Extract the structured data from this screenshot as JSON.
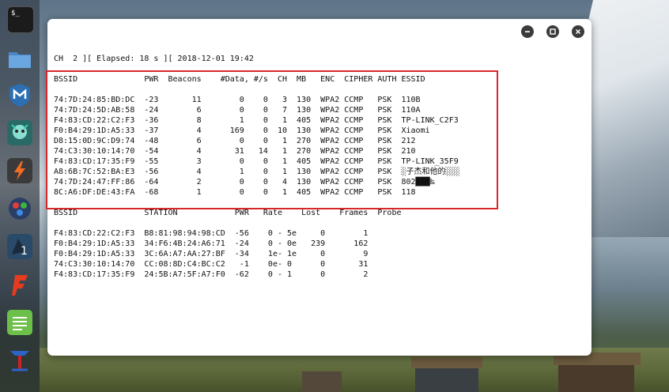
{
  "header_line": "CH  2 ][ Elapsed: 18 s ][ 2018-12-01 19:42",
  "ap_table": {
    "header": "BSSID              PWR  Beacons    #Data, #/s  CH  MB   ENC  CIPHER AUTH ESSID",
    "rows": [
      "74:7D:24:85:BD:DC  -23       11        0    0   3  130  WPA2 CCMP   PSK  110B",
      "74:7D:24:5D:AB:58  -24        6        0    0   7  130  WPA2 CCMP   PSK  110A",
      "F4:83:CD:22:C2:F3  -36        8        1    0   1  405  WPA2 CCMP   PSK  TP-LINK_C2F3",
      "F0:B4:29:1D:A5:33  -37        4      169    0  10  130  WPA2 CCMP   PSK  Xiaomi",
      "D8:15:0D:9C:D9:74  -48        6        0    0   1  270  WPA2 CCMP   PSK  212",
      "74:C3:30:10:14:70  -54        4       31   14   1  270  WPA2 CCMP   PSK  210",
      "F4:83:CD:17:35:F9  -55        3        0    0   1  405  WPA2 CCMP   PSK  TP-LINK_35F9",
      "A8:6B:7C:52:BA:E3  -56        4        1    0   1  130  WPA2 CCMP   PSK  ░子杰和他的░░░",
      "74:7D:24:47:FF:86  -64        2        0    0   4  130  WPA2 CCMP   PSK  802███‰",
      "8C:A6:DF:DE:43:FA  -68        1        0    0   1  405  WPA2 CCMP   PSK  118"
    ]
  },
  "station_table": {
    "header": "BSSID              STATION            PWR   Rate    Lost    Frames  Probe",
    "rows": [
      "F4:83:CD:22:C2:F3  B8:81:98:94:98:CD  -56    0 - 5e     0        1",
      "F0:B4:29:1D:A5:33  34:F6:4B:24:A6:71  -24    0 - 0e   239      162",
      "F0:B4:29:1D:A5:33  3C:6A:A7:AA:27:BF  -34    1e- 1e     0        9",
      "74:C3:30:10:14:70  CC:08:8D:C4:BC:C2   -1    0e- 0      0       31",
      "F4:83:CD:17:35:F9  24:5B:A7:5F:A7:F0  -62    0 - 1      0        2"
    ]
  },
  "dock": {
    "items": [
      {
        "name": "terminal-icon"
      },
      {
        "name": "files-icon"
      },
      {
        "name": "metasploit-icon"
      },
      {
        "name": "armitage-icon"
      },
      {
        "name": "burpsuite-icon"
      },
      {
        "name": "maltego-icon"
      },
      {
        "name": "beef-icon"
      },
      {
        "name": "faraday-icon"
      },
      {
        "name": "leafpad-icon"
      },
      {
        "name": "cutycapt-icon"
      }
    ],
    "terminal_glyph": "$_"
  },
  "colors": {
    "highlight_border": "#d9262a",
    "window_bg": "#ffffff",
    "text": "#111111"
  }
}
